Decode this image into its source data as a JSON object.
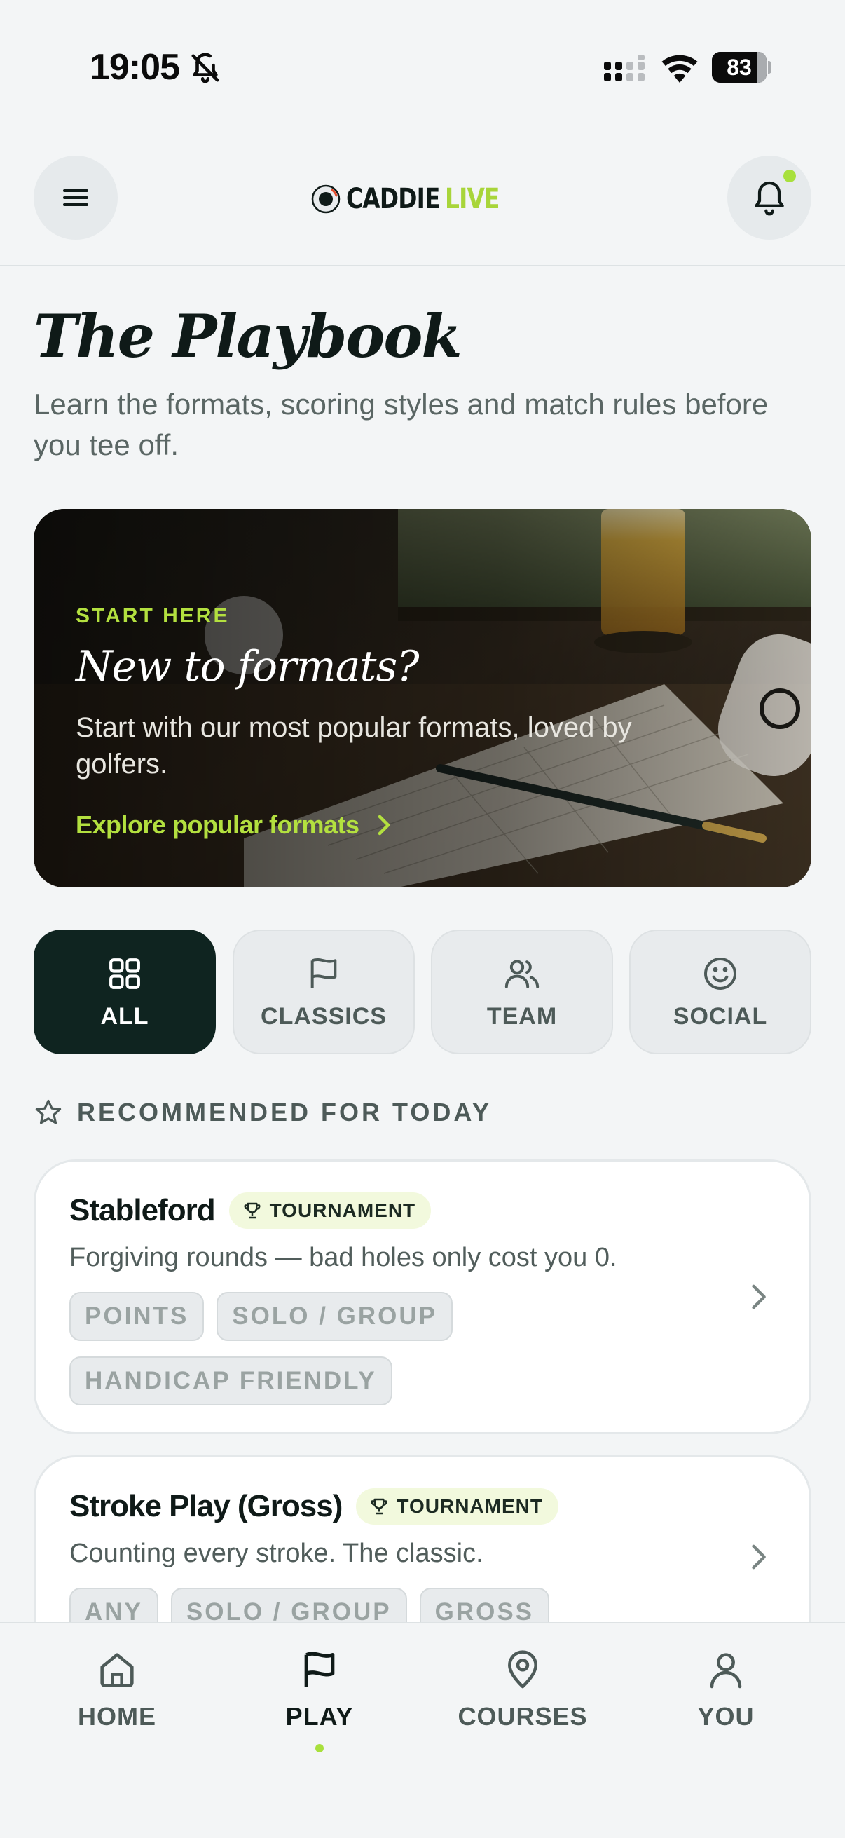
{
  "status_bar": {
    "time": "19:05",
    "battery_level": "83",
    "battery_fraction": 0.83,
    "icons": [
      "bell-muted-icon",
      "signal-icon",
      "wifi-icon",
      "battery-icon"
    ]
  },
  "header": {
    "brand": "CADDIE",
    "brand_suffix": "LIVE",
    "menu_icon": "hamburger-icon",
    "notification_icon": "bell-icon",
    "has_unread_notifications": true
  },
  "page": {
    "title": "The Playbook",
    "subtitle": "Learn the formats, scoring styles and match rules before you tee off."
  },
  "hero": {
    "eyebrow": "START HERE",
    "title": "New to formats?",
    "description": "Start with our most popular formats, loved by golfers.",
    "link_label": "Explore popular formats"
  },
  "filters": [
    {
      "label": "ALL",
      "icon": "grid-icon",
      "active": true
    },
    {
      "label": "CLASSICS",
      "icon": "flag-icon",
      "active": false
    },
    {
      "label": "TEAM",
      "icon": "users-icon",
      "active": false
    },
    {
      "label": "SOCIAL",
      "icon": "smile-icon",
      "active": false
    }
  ],
  "recommended": {
    "heading": "RECOMMENDED FOR TODAY",
    "icon": "star-icon",
    "formats": [
      {
        "title": "Stableford",
        "badge": "TOURNAMENT",
        "description": "Forgiving rounds — bad holes only cost you 0.",
        "tags": [
          "POINTS",
          "SOLO / GROUP",
          "HANDICAP FRIENDLY"
        ]
      },
      {
        "title": "Stroke Play (Gross)",
        "badge": "TOURNAMENT",
        "description": "Counting every stroke. The classic.",
        "tags": [
          "ANY",
          "SOLO / GROUP",
          "GROSS"
        ]
      }
    ]
  },
  "bottom_nav": [
    {
      "label": "HOME",
      "icon": "home-icon",
      "active": false
    },
    {
      "label": "PLAY",
      "icon": "flag-icon",
      "active": true
    },
    {
      "label": "COURSES",
      "icon": "map-pin-icon",
      "active": false
    },
    {
      "label": "YOU",
      "icon": "user-icon",
      "active": false
    }
  ],
  "colors": {
    "accent": "#A8E03C",
    "dark": "#0F2420",
    "background": "#F3F5F6"
  }
}
